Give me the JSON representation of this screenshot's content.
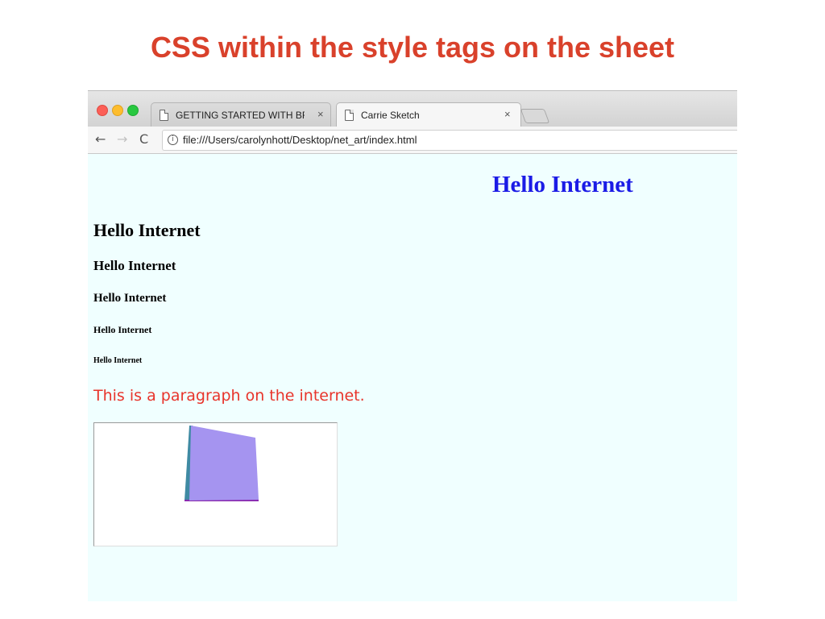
{
  "slide": {
    "title": "CSS within the style tags on the sheet"
  },
  "browser": {
    "tabs": [
      {
        "label": "GETTING STARTED WITH BRA",
        "close": "×",
        "active": false
      },
      {
        "label": "Carrie Sketch",
        "close": "×",
        "active": true
      }
    ],
    "nav": {
      "back_icon": "←",
      "forward_icon": "→",
      "reload_icon": "C",
      "info_icon": "i"
    },
    "url": "file:///Users/carolynhott/Desktop/net_art/index.html"
  },
  "page": {
    "h1": "Hello Internet",
    "h2": "Hello Internet",
    "h3": "Hello Internet",
    "h4": "Hello Internet",
    "h5": "Hello Internet",
    "h6": "Hello Internet",
    "paragraph": "This is a paragraph on the internet."
  },
  "colors": {
    "slide_title": "#d9412b",
    "page_background": "#f0ffff",
    "h1": "#1b1be6",
    "paragraph": "#e8342b",
    "cube_front": "#a594f0",
    "cube_side": "#3f8aa3",
    "cube_bottom": "#8a2bb0"
  }
}
